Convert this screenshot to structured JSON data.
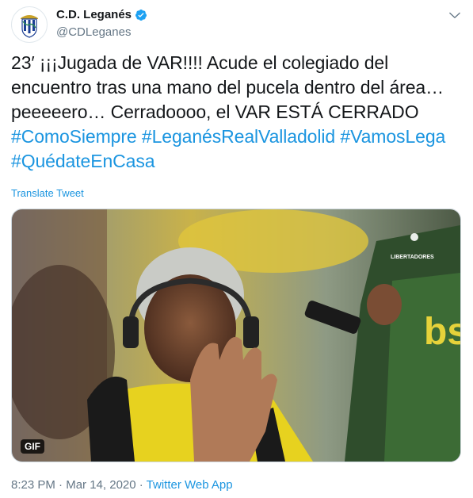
{
  "account": {
    "name": "C.D. Leganés",
    "handle": "@CDLeganes",
    "avatar_icon": "cd-leganes-crest-icon",
    "verified_icon": "verified-badge-icon",
    "verified_color": "#1da1f2"
  },
  "menu_icon": "chevron-down-icon",
  "tweet": {
    "text_parts": [
      "23′ ¡¡¡Jugada de VAR!!!! Acude el colegiado del encuentro tras una mano del pucela dentro del área… peeeeero… Cerradoooo, el VAR ESTÁ CERRADO ",
      "#ComoSiempre",
      " ",
      "#LeganésRealValladolid",
      " ",
      "#VamosLega",
      " ",
      "#QuédateEnCasa"
    ]
  },
  "translate_label": "Translate Tweet",
  "media": {
    "type_badge": "GIF",
    "overlay_text": "LIBERTADORES"
  },
  "meta": {
    "time": "8:23 PM",
    "separator": " · ",
    "date": "Mar 14, 2020",
    "source": "Twitter Web App"
  },
  "colors": {
    "link": "#1b95e0",
    "text": "#14171a",
    "muted": "#657786"
  }
}
